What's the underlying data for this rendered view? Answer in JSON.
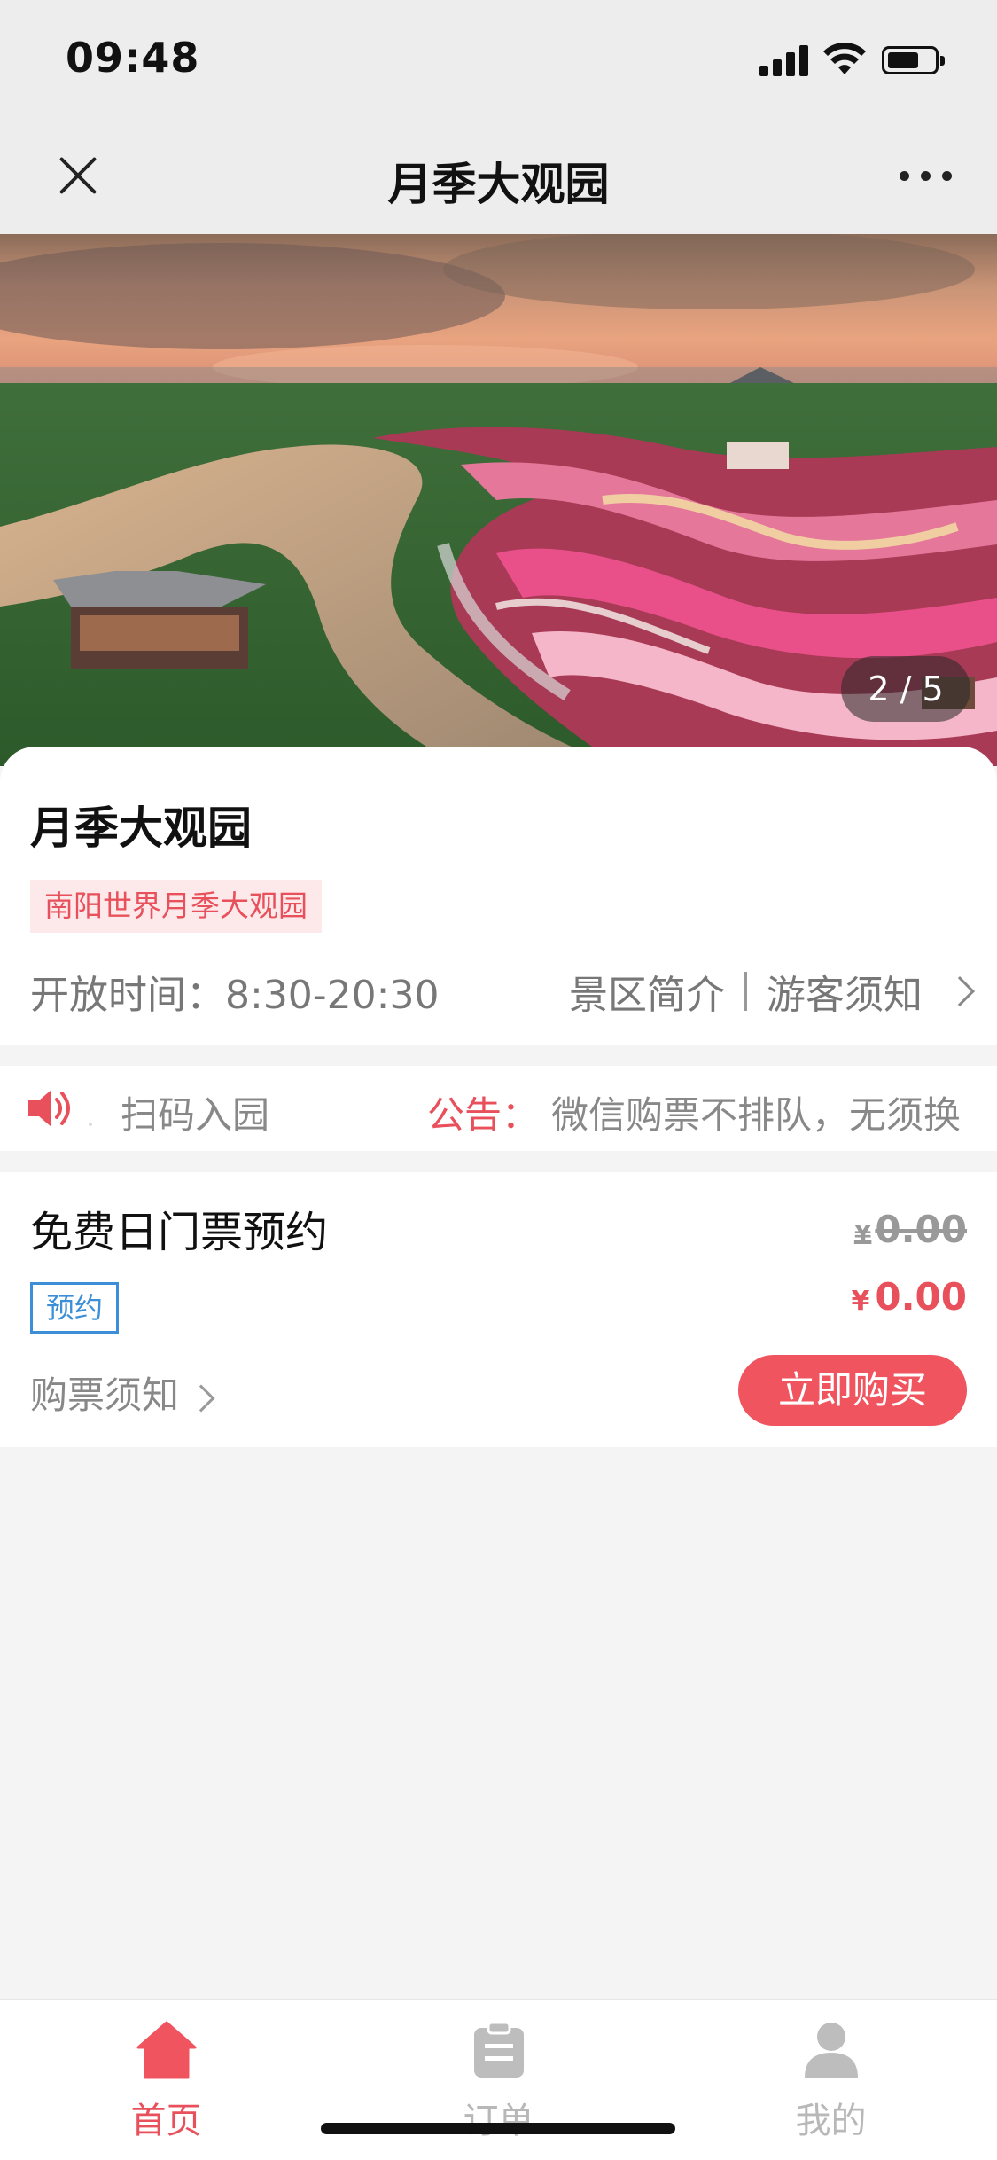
{
  "status_bar": {
    "time": "09:48"
  },
  "nav": {
    "title": "月季大观园"
  },
  "hero": {
    "page_indicator": "2 / 5"
  },
  "info": {
    "name": "月季大观园",
    "tag": "南阳世界月季大观园",
    "open_hours": "开放时间：8:30-20:30",
    "link_intro": "景区简介",
    "link_notice": "游客须知"
  },
  "notice_bar": {
    "scan_text": "扫码入园",
    "label": "公告：",
    "text": "微信购票不排队，无须换"
  },
  "ticket": {
    "name": "免费日门票预约",
    "original_price_symbol": "¥",
    "original_price": "0.00",
    "current_price_symbol": "¥",
    "current_price": "0.00",
    "reserve_tag": "预约",
    "notice_link": "购票须知",
    "buy_button": "立即购买"
  },
  "tab_bar": {
    "tabs": [
      {
        "label": "首页",
        "icon": "home-icon",
        "active": true
      },
      {
        "label": "订单",
        "icon": "clipboard-icon",
        "active": false
      },
      {
        "label": "我的",
        "icon": "user-icon",
        "active": false
      }
    ]
  },
  "colors": {
    "accent": "#e8505b",
    "buy_button": "#f0545f",
    "tag_blue": "#3c8fd6",
    "inactive_tab": "#b8b8b8"
  }
}
